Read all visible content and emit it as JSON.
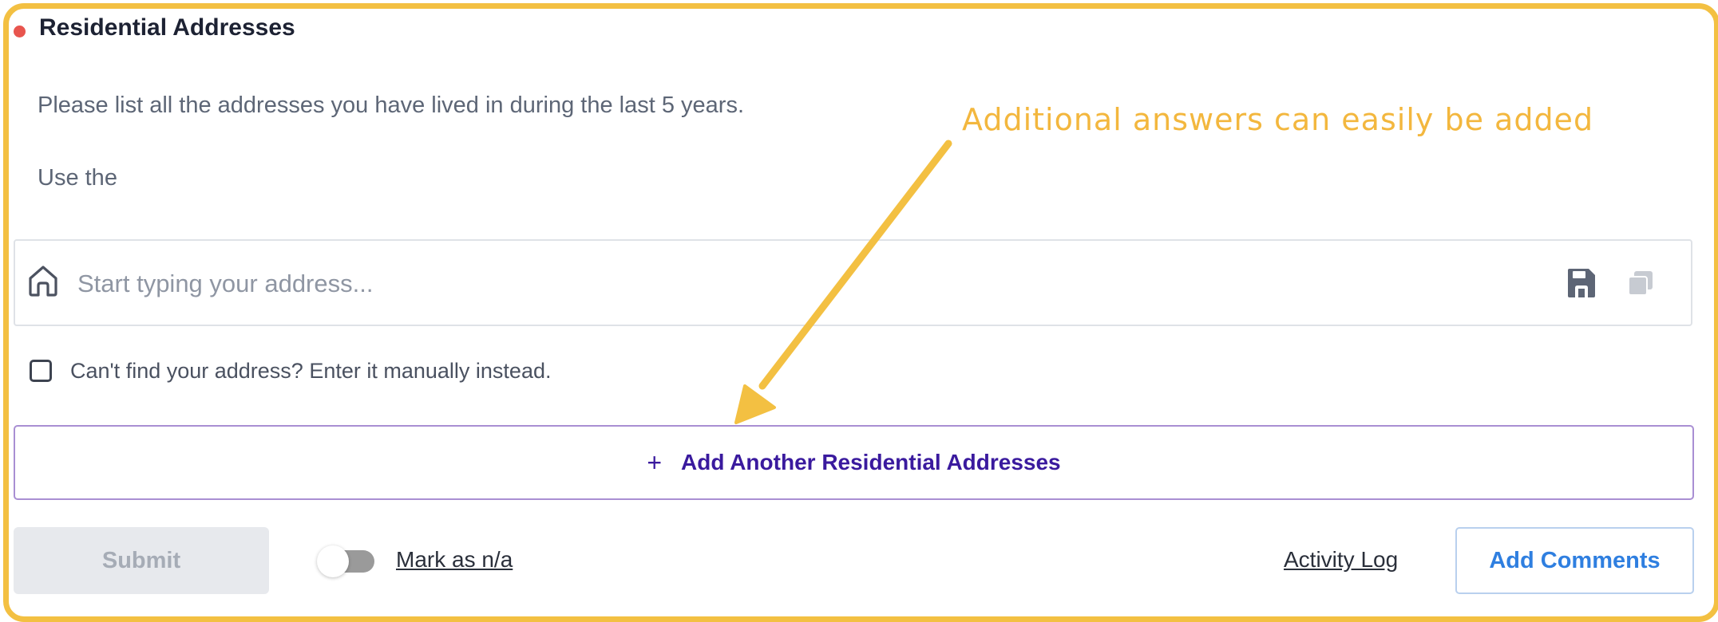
{
  "section": {
    "title": "Residential Addresses",
    "description_line1": "Please list all the addresses you have lived in during the last 5 years.",
    "description_line2": "Use the",
    "status_color": "#e8554e"
  },
  "address_input": {
    "placeholder": "Start typing your address...",
    "value": ""
  },
  "manual_entry": {
    "label": "Can't find your address? Enter it manually instead.",
    "checked": false
  },
  "add_another": {
    "icon": "+",
    "label": "Add Another Residential Addresses"
  },
  "footer": {
    "submit_label": "Submit",
    "mark_na_label": "Mark as n/a",
    "mark_na_on": false,
    "activity_log_label": "Activity Log",
    "add_comments_label": "Add Comments"
  },
  "annotation": {
    "text": "Additional answers can easily be added",
    "color": "#f3b73e"
  },
  "icons": [
    "home-icon",
    "save-icon",
    "copy-icon",
    "plus-icon",
    "arrow-annotation"
  ]
}
